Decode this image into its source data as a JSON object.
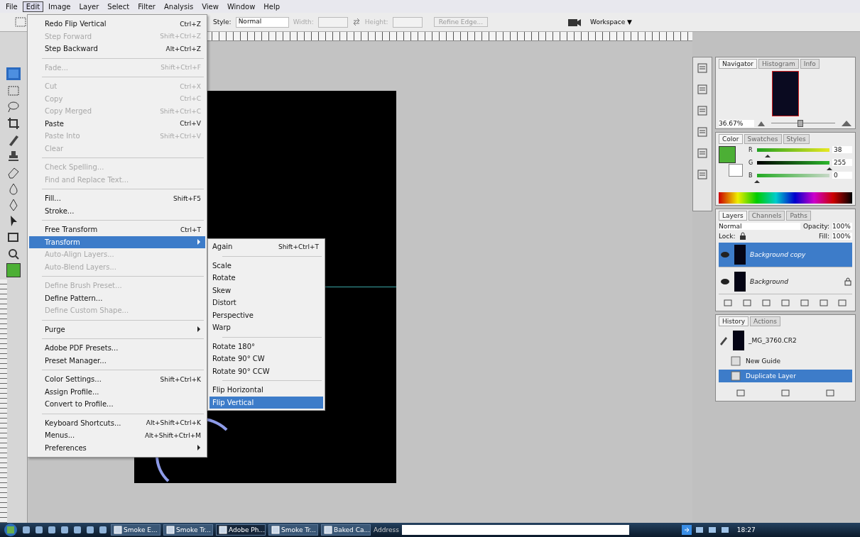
{
  "menubar": [
    {
      "label": "File",
      "selected": false
    },
    {
      "label": "Edit",
      "selected": true
    },
    {
      "label": "Image",
      "selected": false
    },
    {
      "label": "Layer",
      "selected": false
    },
    {
      "label": "Select",
      "selected": false
    },
    {
      "label": "Filter",
      "selected": false
    },
    {
      "label": "Analysis",
      "selected": false
    },
    {
      "label": "View",
      "selected": false
    },
    {
      "label": "Window",
      "selected": false
    },
    {
      "label": "Help",
      "selected": false
    }
  ],
  "options_bar": {
    "style_label": "Style:",
    "style_value": "Normal",
    "width_label": "Width:",
    "height_label": "Height:",
    "refine_button": "Refine Edge...",
    "workspace_button": "Workspace ▼"
  },
  "edit_menu": [
    {
      "kind": "item",
      "label": "Redo Flip Vertical",
      "shortcut": "Ctrl+Z",
      "disabled": false,
      "selected": false,
      "submenu": false
    },
    {
      "kind": "item",
      "label": "Step Forward",
      "shortcut": "Shift+Ctrl+Z",
      "disabled": true,
      "selected": false,
      "submenu": false
    },
    {
      "kind": "item",
      "label": "Step Backward",
      "shortcut": "Alt+Ctrl+Z",
      "disabled": false,
      "selected": false,
      "submenu": false
    },
    {
      "kind": "separator"
    },
    {
      "kind": "item",
      "label": "Fade...",
      "shortcut": "Shift+Ctrl+F",
      "disabled": true,
      "selected": false,
      "submenu": false
    },
    {
      "kind": "separator"
    },
    {
      "kind": "item",
      "label": "Cut",
      "shortcut": "Ctrl+X",
      "disabled": true,
      "selected": false,
      "submenu": false
    },
    {
      "kind": "item",
      "label": "Copy",
      "shortcut": "Ctrl+C",
      "disabled": true,
      "selected": false,
      "submenu": false
    },
    {
      "kind": "item",
      "label": "Copy Merged",
      "shortcut": "Shift+Ctrl+C",
      "disabled": true,
      "selected": false,
      "submenu": false
    },
    {
      "kind": "item",
      "label": "Paste",
      "shortcut": "Ctrl+V",
      "disabled": false,
      "selected": false,
      "submenu": false
    },
    {
      "kind": "item",
      "label": "Paste Into",
      "shortcut": "Shift+Ctrl+V",
      "disabled": true,
      "selected": false,
      "submenu": false
    },
    {
      "kind": "item",
      "label": "Clear",
      "disabled": true,
      "selected": false,
      "submenu": false
    },
    {
      "kind": "separator"
    },
    {
      "kind": "item",
      "label": "Check Spelling...",
      "disabled": true,
      "selected": false,
      "submenu": false
    },
    {
      "kind": "item",
      "label": "Find and Replace Text...",
      "disabled": true,
      "selected": false,
      "submenu": false
    },
    {
      "kind": "separator"
    },
    {
      "kind": "item",
      "label": "Fill...",
      "shortcut": "Shift+F5",
      "disabled": false,
      "selected": false,
      "submenu": false
    },
    {
      "kind": "item",
      "label": "Stroke...",
      "disabled": false,
      "selected": false,
      "submenu": false
    },
    {
      "kind": "separator"
    },
    {
      "kind": "item",
      "label": "Free Transform",
      "shortcut": "Ctrl+T",
      "disabled": false,
      "selected": false,
      "submenu": false
    },
    {
      "kind": "item",
      "label": "Transform",
      "disabled": false,
      "selected": true,
      "submenu": true
    },
    {
      "kind": "item",
      "label": "Auto-Align Layers...",
      "disabled": true,
      "selected": false,
      "submenu": false
    },
    {
      "kind": "item",
      "label": "Auto-Blend Layers...",
      "disabled": true,
      "selected": false,
      "submenu": false
    },
    {
      "kind": "separator"
    },
    {
      "kind": "item",
      "label": "Define Brush Preset...",
      "disabled": true,
      "selected": false,
      "submenu": false
    },
    {
      "kind": "item",
      "label": "Define Pattern...",
      "disabled": false,
      "selected": false,
      "submenu": false
    },
    {
      "kind": "item",
      "label": "Define Custom Shape...",
      "disabled": true,
      "selected": false,
      "submenu": false
    },
    {
      "kind": "separator"
    },
    {
      "kind": "item",
      "label": "Purge",
      "disabled": false,
      "selected": false,
      "submenu": true
    },
    {
      "kind": "separator"
    },
    {
      "kind": "item",
      "label": "Adobe PDF Presets...",
      "disabled": false,
      "selected": false,
      "submenu": false
    },
    {
      "kind": "item",
      "label": "Preset Manager...",
      "disabled": false,
      "selected": false,
      "submenu": false
    },
    {
      "kind": "separator"
    },
    {
      "kind": "item",
      "label": "Color Settings...",
      "shortcut": "Shift+Ctrl+K",
      "disabled": false,
      "selected": false,
      "submenu": false
    },
    {
      "kind": "item",
      "label": "Assign Profile...",
      "disabled": false,
      "selected": false,
      "submenu": false
    },
    {
      "kind": "item",
      "label": "Convert to Profile...",
      "disabled": false,
      "selected": false,
      "submenu": false
    },
    {
      "kind": "separator"
    },
    {
      "kind": "item",
      "label": "Keyboard Shortcuts...",
      "shortcut": "Alt+Shift+Ctrl+K",
      "disabled": false,
      "selected": false,
      "submenu": false
    },
    {
      "kind": "item",
      "label": "Menus...",
      "shortcut": "Alt+Shift+Ctrl+M",
      "disabled": false,
      "selected": false,
      "submenu": false
    },
    {
      "kind": "item",
      "label": "Preferences",
      "disabled": false,
      "selected": false,
      "submenu": true
    }
  ],
  "transform_submenu": [
    {
      "kind": "item",
      "label": "Again",
      "shortcut": "Shift+Ctrl+T",
      "selected": false
    },
    {
      "kind": "separator"
    },
    {
      "kind": "item",
      "label": "Scale",
      "selected": false
    },
    {
      "kind": "item",
      "label": "Rotate",
      "selected": false
    },
    {
      "kind": "item",
      "label": "Skew",
      "selected": false
    },
    {
      "kind": "item",
      "label": "Distort",
      "selected": false
    },
    {
      "kind": "item",
      "label": "Perspective",
      "selected": false
    },
    {
      "kind": "item",
      "label": "Warp",
      "selected": false
    },
    {
      "kind": "separator"
    },
    {
      "kind": "item",
      "label": "Rotate 180°",
      "selected": false
    },
    {
      "kind": "item",
      "label": "Rotate 90° CW",
      "selected": false
    },
    {
      "kind": "item",
      "label": "Rotate 90° CCW",
      "selected": false
    },
    {
      "kind": "separator"
    },
    {
      "kind": "item",
      "label": "Flip Horizontal",
      "selected": false
    },
    {
      "kind": "item",
      "label": "Flip Vertical",
      "selected": true
    }
  ],
  "navigator": {
    "tabs": [
      {
        "label": "Navigator",
        "selected": true
      },
      {
        "label": "Histogram",
        "selected": false
      },
      {
        "label": "Info",
        "selected": false
      }
    ],
    "zoom": "36.67%",
    "level": 0.45
  },
  "color": {
    "tabs": [
      {
        "label": "Color",
        "selected": true
      },
      {
        "label": "Swatches",
        "selected": false
      },
      {
        "label": "Styles",
        "selected": false
      }
    ],
    "channels": [
      {
        "label": "R",
        "level": 0.15,
        "value": "38"
      },
      {
        "label": "G",
        "level": 1.0,
        "value": "255"
      },
      {
        "label": "B",
        "level": 0.0,
        "value": "0"
      }
    ]
  },
  "layers": {
    "tabs": [
      {
        "label": "Layers",
        "selected": true
      },
      {
        "label": "Channels",
        "selected": false
      },
      {
        "label": "Paths",
        "selected": false
      }
    ],
    "blend_mode": "Normal",
    "opacity_label": "Opacity:",
    "opacity": "100%",
    "lock_label": "Lock:",
    "fill_label": "Fill:",
    "fill": "100%",
    "items": [
      {
        "name": "Background copy",
        "selected": true,
        "locked": false
      },
      {
        "name": "Background",
        "selected": false,
        "locked": true
      }
    ]
  },
  "history": {
    "tabs": [
      {
        "label": "History",
        "selected": true
      },
      {
        "label": "Actions",
        "selected": false
      }
    ],
    "snapshot": "_MG_3760.CR2",
    "items": [
      {
        "label": "New Guide",
        "selected": false
      },
      {
        "label": "Duplicate Layer",
        "selected": true
      }
    ]
  },
  "taskbar": {
    "buttons": [
      {
        "label": "Smoke E...",
        "selected": false
      },
      {
        "label": "Smoke Tr...",
        "selected": false
      },
      {
        "label": "Adobe Ph...",
        "selected": true
      },
      {
        "label": "Smoke Tr...",
        "selected": false
      },
      {
        "label": "Baked Ca...",
        "selected": false
      }
    ],
    "address_label": "Address",
    "clock": "18:27"
  }
}
